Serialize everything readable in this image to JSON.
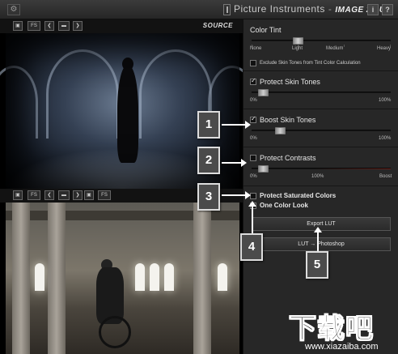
{
  "app": {
    "brand": "Picture Instruments",
    "separator": "-",
    "product": "IMAGE 2 LUT",
    "info_label": "i",
    "help_label": "?"
  },
  "source_pane": {
    "label": "SOURCE",
    "toolbar": {
      "fs_label": "FS",
      "icons": [
        "camera-icon",
        "fs-toggle-icon",
        "prev-icon",
        "folder-icon",
        "next-icon"
      ]
    }
  },
  "target_pane": {
    "toolbar": {
      "fs_label": "FS",
      "icons": [
        "camera-icon",
        "fs-toggle-icon",
        "prev-icon",
        "folder-icon",
        "next-icon",
        "save-icon",
        "fs-toggle-icon"
      ]
    }
  },
  "color_tint": {
    "title": "Color Tint",
    "scale": [
      "None",
      "Light",
      "Medium",
      "Heavy"
    ],
    "value": "Light",
    "exclude_label": "Exclude Skin Tones from Tint Color Calculation",
    "exclude_checked": false
  },
  "protect_skin": {
    "label": "Protect Skin Tones",
    "checked": true,
    "min_label": "0%",
    "max_label": "100%",
    "value_percent": 5
  },
  "boost_skin": {
    "label": "Boost Skin Tones",
    "checked": true,
    "min_label": "0%",
    "max_label": "100%",
    "value_percent": 18
  },
  "protect_contrasts": {
    "label": "Protect Contrasts",
    "checked": false,
    "min_label": "0%",
    "mid_label": "100%",
    "max_label": "Boost",
    "value_percent": 5
  },
  "protect_saturated": {
    "label": "Protect Saturated Colors",
    "checked": false
  },
  "one_color_look": {
    "label": "One Color Look",
    "checked": false
  },
  "buttons": {
    "export_lut": "Export LUT",
    "lut_to_photoshop": "LUT → Photoshop"
  },
  "callouts": [
    "1",
    "2",
    "3",
    "4",
    "5"
  ],
  "watermark": {
    "main": "下载吧",
    "url": "www.xiazaiba.com"
  },
  "colors": {
    "panel_bg": "#272727",
    "callout_bg": "#4b4b4b",
    "boost_track_red": "#6a2018"
  }
}
